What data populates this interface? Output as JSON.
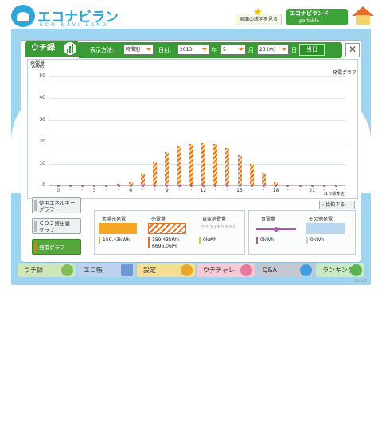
{
  "header": {
    "logo_text": "エコナビランド",
    "logo_sub": "ECO NAVI LAND",
    "help_label": "画面の説明を見る",
    "portable_label_1": "エコナビランド",
    "portable_label_2": "portable",
    "icons": {
      "home": "house-icon",
      "star": "star-icon"
    }
  },
  "tab": {
    "label": "ウチ録",
    "icon": "bar-graph-icon"
  },
  "toolbar": {
    "display_method_label": "表示方法:",
    "display_method_value": "時間別",
    "date_label": "日付:",
    "year_value": "2013",
    "year_label": "年",
    "month_value": "5",
    "month_label": "月",
    "day_value": "23 (木)",
    "day_label": "日",
    "today_label": "当日"
  },
  "side_buttons": [
    {
      "label_1": "使用エネルギー",
      "label_2": "グラフ"
    },
    {
      "label_1": "ＣＯ２排出量",
      "label_2": "グラフ"
    },
    {
      "label_1": "発電グラフ",
      "label_2": ""
    }
  ],
  "chart_data": {
    "type": "bar",
    "title": "発電グラフ",
    "ylabel": "発電量",
    "yunit": "(kWh)",
    "ylim": [
      0,
      50
    ],
    "y_ticks": [
      "50",
      "40",
      "30",
      "20",
      "10",
      "0"
    ],
    "x_ticks": [
      "0",
      "3",
      "6",
      "9",
      "12",
      "15",
      "18",
      "21"
    ],
    "x": [
      0,
      1,
      2,
      3,
      4,
      5,
      6,
      7,
      8,
      9,
      10,
      11,
      12,
      13,
      14,
      15,
      16,
      17,
      18,
      19,
      20,
      21,
      22,
      23
    ],
    "values": [
      0,
      0,
      0,
      0,
      0,
      0.3,
      1.5,
      5.5,
      11,
      15.5,
      18,
      19,
      19.5,
      19,
      17,
      14,
      10,
      6,
      1.5,
      0,
      0,
      0,
      0,
      0
    ],
    "series_color": "#e8711b",
    "footnote": "(1日積算値)"
  },
  "compare_label": "比較する",
  "stats": {
    "solar": {
      "label": "太陽光発電",
      "value": "159.43kWh",
      "color": "#f5a623"
    },
    "sold": {
      "label": "売電量",
      "value": "159.43kWh",
      "amount": "6696.06円",
      "color": "#e8711b"
    },
    "self": {
      "label": "自家消費量",
      "note": "グラフはありません",
      "value": "0kWh",
      "color": "#d3c84a"
    },
    "bought": {
      "label": "買電量",
      "value": "0kWh",
      "color": "#a75aa5"
    },
    "other": {
      "label": "その他発電",
      "value": "0kWh",
      "color": "#b8d7ef"
    }
  },
  "nav": [
    {
      "label": "ウチ録",
      "color": "#cfe6b8",
      "icon": "bar-graph-icon"
    },
    {
      "label": "エコ帳",
      "color": "#bcd2ee",
      "icon": "notebook-icon"
    },
    {
      "label": "設定",
      "color": "#f6df92",
      "icon": "wrench-icon"
    },
    {
      "label": "ウチチャレ",
      "color": "#f6c9d6",
      "icon": "flag-icon"
    },
    {
      "label": "Q&A",
      "color": "#c7c7d4",
      "icon": "question-icon"
    },
    {
      "label": "ランキング",
      "color": "#c9ebc2",
      "icon": "crown-icon"
    }
  ],
  "version": "V1.6.6"
}
